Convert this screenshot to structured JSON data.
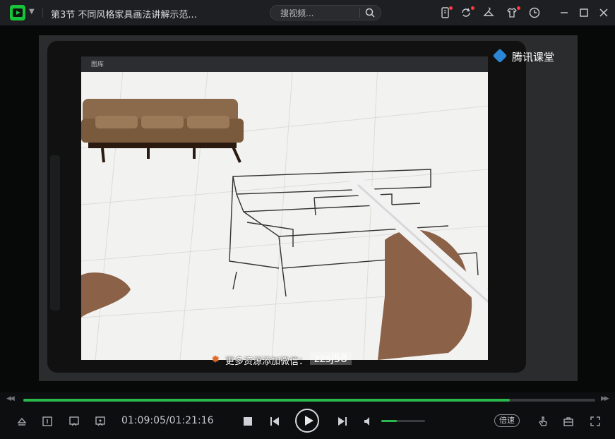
{
  "titlebar": {
    "title": "第3节 不同风格家具画法讲解示范...",
    "search_placeholder": "搜视频...",
    "icons": [
      "player-logo-icon",
      "chevron-down-icon",
      "search-icon",
      "phone-icon",
      "refresh-icon",
      "clothes-hanger-icon",
      "shirt-icon",
      "clock-icon",
      "minimize-icon",
      "maximize-icon",
      "close-icon"
    ]
  },
  "video": {
    "app_menu": "图库",
    "watermark": "腾讯课堂",
    "promo_text": "更多资源添加微信：",
    "promo_id": "zzsj58"
  },
  "player": {
    "time": "01:09:05/01:21:16",
    "progress": 0.85,
    "volume": 0.35,
    "speed_label": "倍速",
    "accent": "#2ab84c"
  }
}
